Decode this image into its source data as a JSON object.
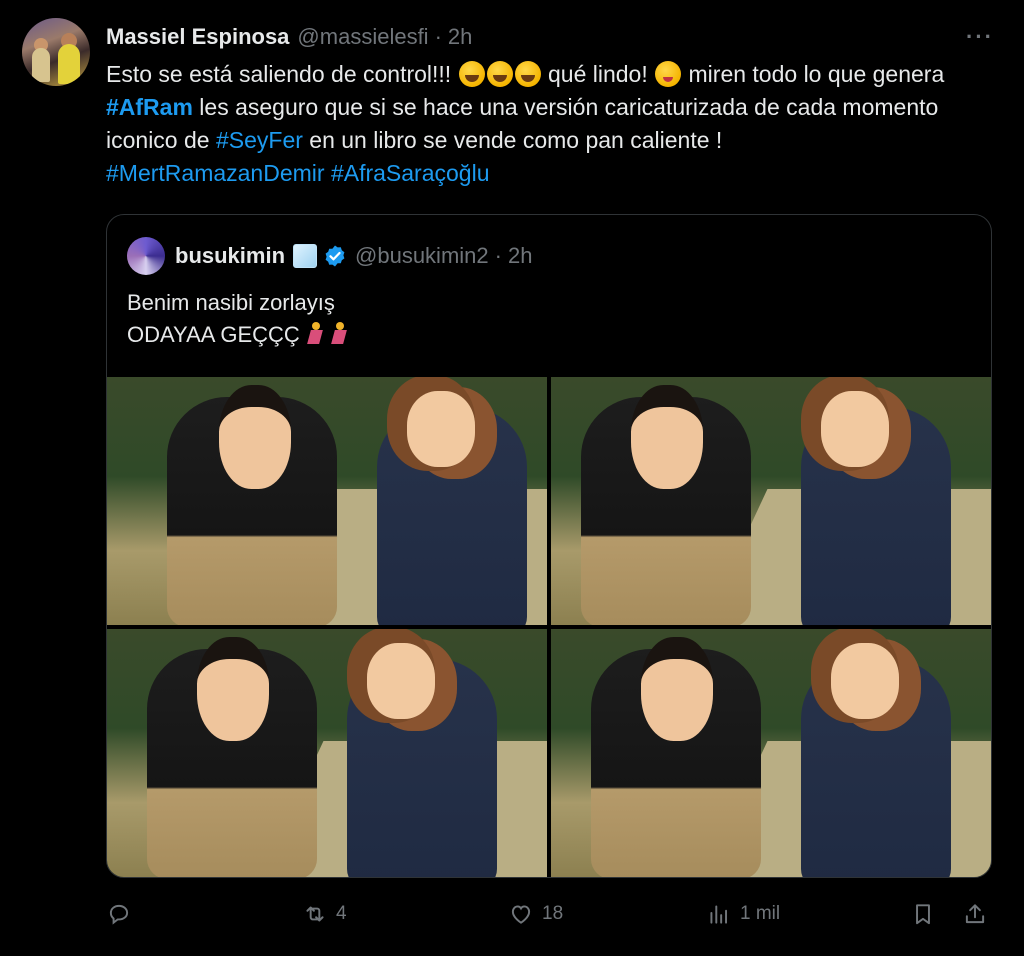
{
  "tweet": {
    "author_name": "Massiel Espinosa",
    "author_handle": "@massielesfi",
    "separator": "·",
    "time": "2h",
    "more_label": "···",
    "text": {
      "part1": "Esto se está saliendo de control!!! ",
      "part2": " qué lindo! ",
      "part3": " miren todo lo que genera ",
      "tag1": "#AfRam",
      "part4": " les aseguro que si se hace una versión caricaturizada de cada momento iconico de ",
      "tag2": "#SeyFer",
      "part5": " en un libro se vende como pan caliente !",
      "tag3": "#MertRamazanDemir",
      "tag4": "#AfraSaraçoğlu"
    }
  },
  "quote": {
    "author_name": "busukimin",
    "author_handle": "@busukimin2",
    "separator": "·",
    "time": "2h",
    "line1": "Benim nasibi zorlayış",
    "line2": "ODAYAA GEÇÇÇ"
  },
  "actions": {
    "replies": "",
    "reposts": "4",
    "likes": "18",
    "views": "1 mil"
  },
  "colors": {
    "background": "#000000",
    "text": "#e7e9ea",
    "muted": "#71767b",
    "link": "#1d9bf0",
    "border": "#2f3336"
  },
  "icons": [
    "more-icon",
    "verified-icon",
    "reply-icon",
    "repost-icon",
    "like-icon",
    "views-icon",
    "bookmark-icon",
    "share-icon"
  ]
}
